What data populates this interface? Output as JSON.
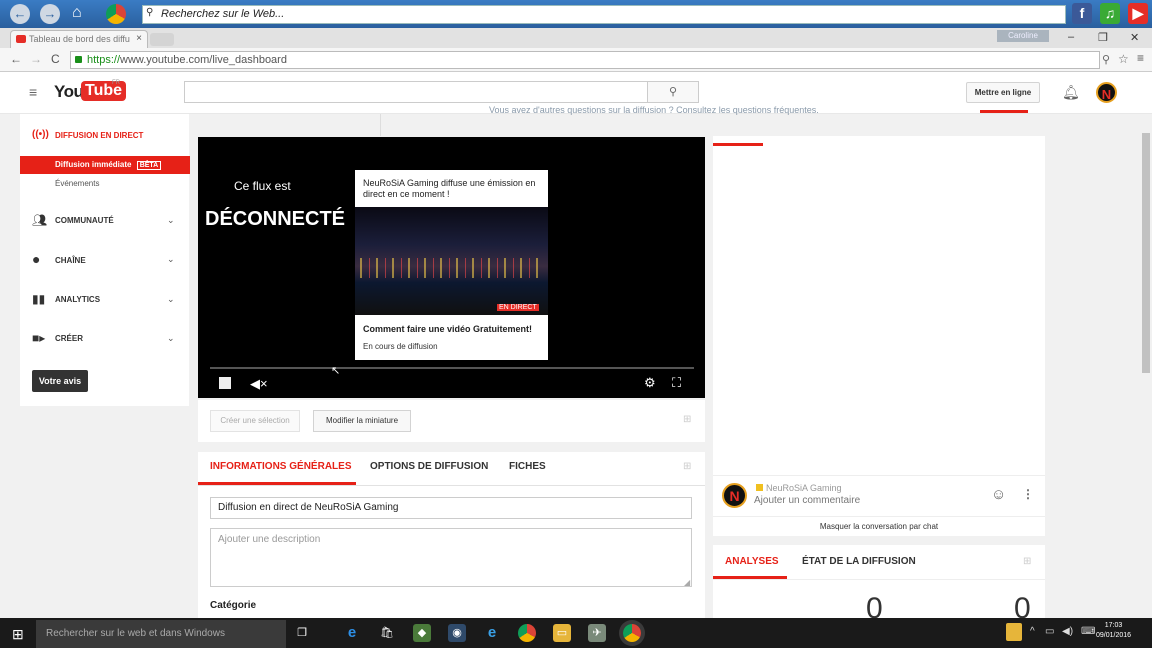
{
  "browser": {
    "web_search_placeholder": "Recherchez sur le Web...",
    "tab_title": "Tableau de bord des diffu",
    "tab_close": "×",
    "user_badge": "Caroline",
    "window_min": "–",
    "window_max": "❐",
    "window_close": "✕",
    "url_https": "https://",
    "url_rest": "www.youtube.com/live_dashboard",
    "nav_back": "←",
    "nav_forward": "→",
    "nav_reload": "C"
  },
  "youtube": {
    "logo_you": "You",
    "logo_tube": "Tube",
    "logo_region": "FR",
    "upload_label": "Mettre en ligne",
    "avatar_letter": "N"
  },
  "sidebar": {
    "live_label": "DIFFUSION EN DIRECT",
    "sub_items": [
      {
        "label": "Diffusion immédiate",
        "badge": "BÊTA"
      },
      {
        "label": "Événements"
      }
    ],
    "sections": [
      {
        "label": "COMMUNAUTÉ",
        "icon": "people-icon"
      },
      {
        "label": "CHAÎNE",
        "icon": "account-icon"
      },
      {
        "label": "ANALYTICS",
        "icon": "bar-chart-icon"
      },
      {
        "label": "CRÉER",
        "icon": "video-camera-icon"
      }
    ],
    "feedback_label": "Votre avis"
  },
  "notice": {
    "text": "Vous avez d'autres questions sur la diffusion ? Consultez les questions fréquentes."
  },
  "player": {
    "offline_line1": "Ce flux est",
    "offline_line2": "DÉCONNECTÉ",
    "card_title": "NeuRoSiA Gaming diffuse une émission en direct en ce moment !",
    "card_live_badge": "EN DIRECT",
    "card_video_title": "Comment faire une vidéo Gratuitement!",
    "card_status": "En cours de diffusion"
  },
  "actions": {
    "create_clip": "Créer une sélection",
    "edit_thumbnail": "Modifier la miniature"
  },
  "info_tabs": {
    "tabs": [
      "INFORMATIONS GÉNÉRALES",
      "OPTIONS DE DIFFUSION",
      "FICHES"
    ],
    "active": 0,
    "title_value": "Diffusion en direct de NeuRoSiA Gaming",
    "description_placeholder": "Ajouter une description",
    "category_label": "Catégorie"
  },
  "chat": {
    "user_name": "NeuRoSiA Gaming",
    "comment_placeholder": "Ajouter un commentaire",
    "hide_label": "Masquer la conversation par chat"
  },
  "analytics": {
    "tabs": [
      "ANALYSES",
      "ÉTAT DE LA DIFFUSION"
    ],
    "active": 0,
    "value_left": "0",
    "value_right": "0"
  },
  "taskbar": {
    "search_placeholder": "Rechercher sur le web et dans Windows",
    "time": "17:03",
    "date": "09/01/2016"
  },
  "colors": {
    "accent": "#e62117",
    "ie_toolbar": "#2a5f9e",
    "taskbar": "#1a1a1a"
  }
}
